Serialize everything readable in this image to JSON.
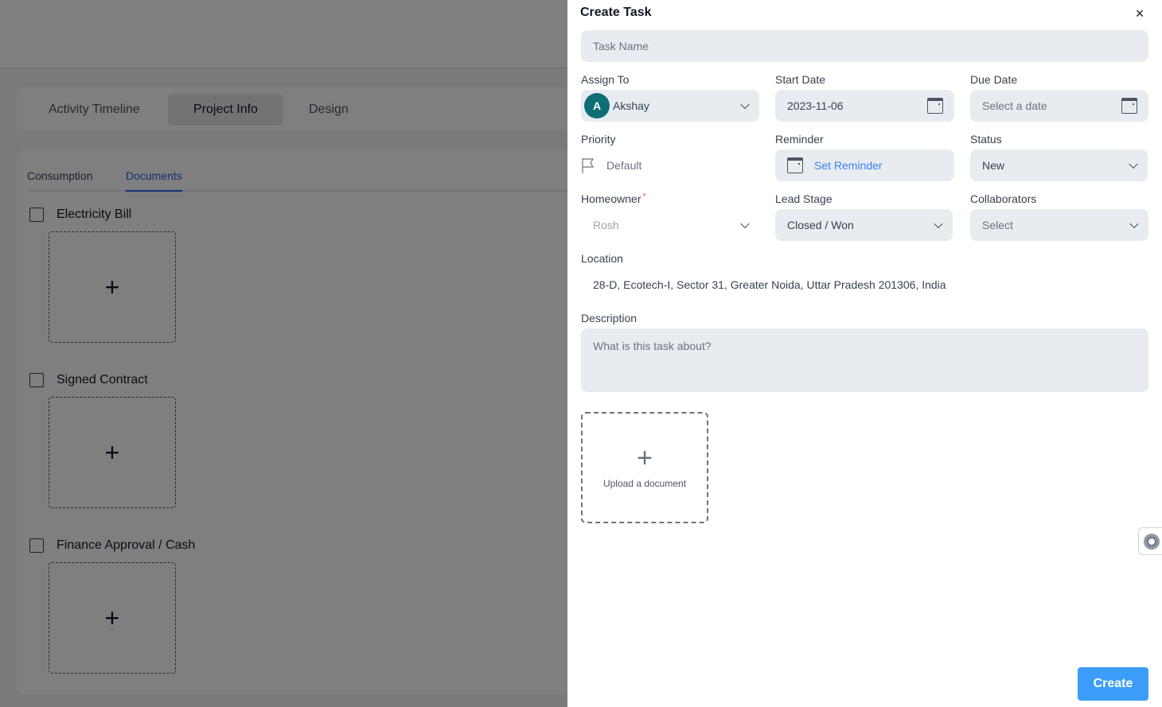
{
  "background": {
    "tabs": [
      {
        "label": "Activity Timeline",
        "active": false
      },
      {
        "label": "Project Info",
        "active": true
      },
      {
        "label": "Design",
        "active": false
      }
    ],
    "subtabs": [
      {
        "label": "Consumption",
        "active": false
      },
      {
        "label": "Documents",
        "active": true
      }
    ],
    "documents": [
      {
        "title": "Electricity Bill",
        "checked": false,
        "add_icon": "+"
      },
      {
        "title": "Signed Contract",
        "checked": false,
        "add_icon": "+"
      },
      {
        "title": "Finance Approval / Cash",
        "checked": false,
        "add_icon": "+"
      }
    ]
  },
  "drawer": {
    "title": "Create Task",
    "close_icon": "×",
    "task_name": {
      "placeholder": "Task Name",
      "value": ""
    },
    "assign_to": {
      "label": "Assign To",
      "avatar_initial": "A",
      "value": "Akshay",
      "avatar_color": "#0f6e75"
    },
    "start_date": {
      "label": "Start Date",
      "value": "2023-11-06"
    },
    "due_date": {
      "label": "Due Date",
      "placeholder": "Select a date"
    },
    "priority": {
      "label": "Priority",
      "value": "Default"
    },
    "reminder": {
      "label": "Reminder",
      "value": "Set Reminder"
    },
    "status": {
      "label": "Status",
      "value": "New"
    },
    "homeowner": {
      "label": "Homeowner",
      "required_mark": "*",
      "value": "Rosh"
    },
    "lead_stage": {
      "label": "Lead Stage",
      "value": "Closed / Won"
    },
    "collaborators": {
      "label": "Collaborators",
      "placeholder": "Select"
    },
    "location": {
      "label": "Location",
      "value": "28-D, Ecotech-I, Sector 31, Greater Noida, Uttar Pradesh 201306, India"
    },
    "description": {
      "label": "Description",
      "placeholder": "What is this task about?"
    },
    "upload": {
      "icon": "+",
      "label": "Upload a document"
    },
    "create_label": "Create"
  },
  "colors": {
    "accent": "#3b9df8",
    "link": "#3b82f6",
    "field_bg": "#e8ecf0",
    "required": "#ef4444"
  }
}
